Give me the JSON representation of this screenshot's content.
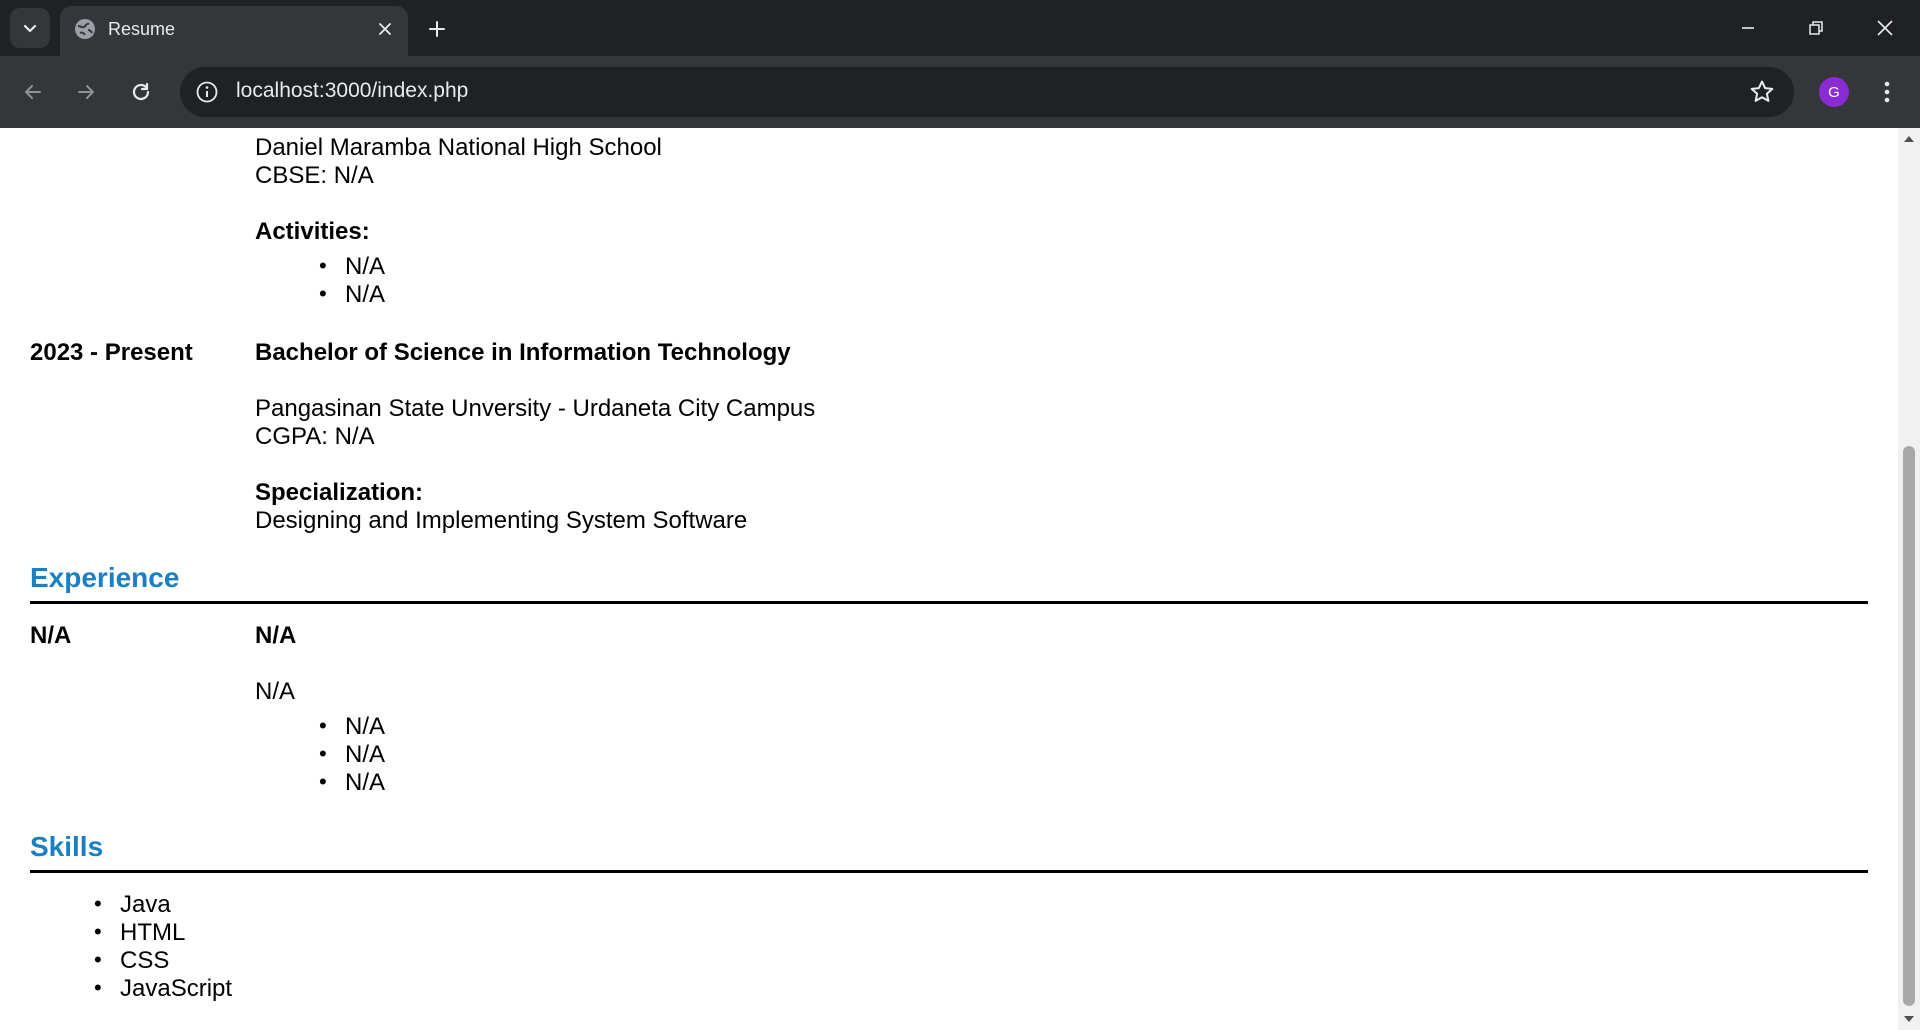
{
  "browser": {
    "tab_title": "Resume",
    "url": "localhost:3000/index.php",
    "profile_initial": "G"
  },
  "education": {
    "school1": {
      "name": "Daniel Maramba National High School",
      "grade": "CBSE: N/A",
      "activities_label": "Activities:",
      "activities": [
        "N/A",
        "N/A"
      ]
    },
    "school2": {
      "period": "2023 - Present",
      "degree": "Bachelor of Science in Information Technology",
      "name": "Pangasinan State Unversity - Urdaneta City Campus",
      "grade": "CGPA: N/A",
      "specialization_label": "Specialization:",
      "specialization": "Designing and Implementing System Software"
    }
  },
  "experience": {
    "title": "Experience",
    "period": "N/A",
    "role": "N/A",
    "description": "N/A",
    "items": [
      "N/A",
      "N/A",
      "N/A"
    ]
  },
  "skills": {
    "title": "Skills",
    "items": [
      "Java",
      "HTML",
      "CSS",
      "JavaScript"
    ]
  },
  "colors": {
    "section_title": "#1a7fc4",
    "chrome_dark": "#202124",
    "chrome_toolbar": "#35363a",
    "avatar": "#8a2bd4"
  }
}
